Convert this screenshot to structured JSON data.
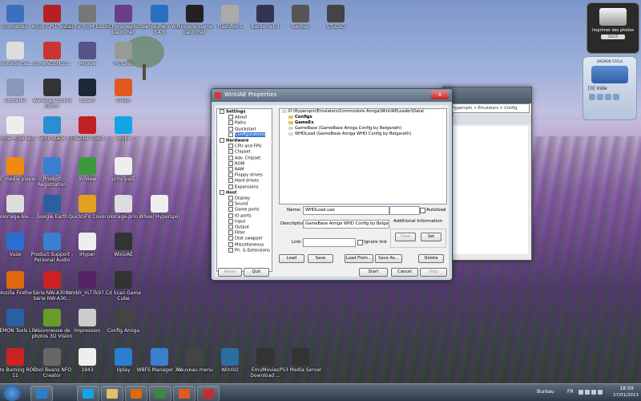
{
  "desktop_icons": [
    {
      "label": "Ordinateur",
      "color": "#3a70c0"
    },
    {
      "label": "ASUS GPU Tweak",
      "color": "#b52020"
    },
    {
      "label": "Gui for ROM Editor",
      "color": "#777777"
    },
    {
      "label": "Clrmamepro Launcher",
      "color": "#6a3d8a"
    },
    {
      "label": "OpenSkiPack Win 3.4.1",
      "color": "#2a6fc0"
    },
    {
      "label": "Pinnacle Game Launcher",
      "color": "#222222"
    },
    {
      "label": "Flashfire 2",
      "color": "#aaaaaa"
    },
    {
      "label": "Battle.net 3",
      "color": "#333355"
    },
    {
      "label": "Backup",
      "color": "#555555"
    },
    {
      "label": "STUDIO",
      "color": "#444444"
    },
    {
      "label": "coloriage-cas...",
      "color": "#dddddd"
    },
    {
      "label": "10_WNDSHOT...",
      "color": "#cc3333"
    },
    {
      "label": "Mirage",
      "color": "#555588"
    },
    {
      "label": "Pictures",
      "color": "#999999"
    },
    {
      "label": "Corbeille",
      "color": "#8899bb"
    },
    {
      "label": "WavePad Sound Editor",
      "color": "#333333"
    },
    {
      "label": "Steam",
      "color": "#1b2838"
    },
    {
      "label": "Origin",
      "color": "#e05a20"
    },
    {
      "label": "normal_colorie...",
      "color": "#eeeeee"
    },
    {
      "label": "SonicStage",
      "color": "#2a8fd0"
    },
    {
      "label": "FileZilla Client",
      "color": "#c02020"
    },
    {
      "label": "Skype",
      "color": "#12a5e3"
    },
    {
      "label": "VLC media player",
      "color": "#f08a10"
    },
    {
      "label": "Product Registration",
      "color": "#3a7fd0"
    },
    {
      "label": "XnView",
      "color": "#3a9a3a"
    },
    {
      "label": "principal5",
      "color": "#eeeeee"
    },
    {
      "label": "coloriage-ble...",
      "color": "#dddddd"
    },
    {
      "label": "Google Earth",
      "color": "#2a5fa0"
    },
    {
      "label": "QuickSFV Cover",
      "color": "#e0a020"
    },
    {
      "label": "coloriage-prin...",
      "color": "#dddddd"
    },
    {
      "label": "Wheel Hyperspin",
      "color": "#eeeeee"
    },
    {
      "label": "Vuze",
      "color": "#2a6fd0"
    },
    {
      "label": "Product Support - Personal Audio",
      "color": "#3a7fd0"
    },
    {
      "label": "iHyper",
      "color": "#eeeeee"
    },
    {
      "label": "WinUAE",
      "color": "#333333"
    },
    {
      "label": "Mozilla Firefox",
      "color": "#e06a10"
    },
    {
      "label": "Série NW-A3000 Série NW-A30...",
      "color": "#cc2222"
    },
    {
      "label": "tumblr_m77k97...",
      "color": "#552266"
    },
    {
      "label": "Cd Scan Game Cube",
      "color": "#333333"
    },
    {
      "label": "DAEMON Tools Lite",
      "color": "#2a5fa0"
    },
    {
      "label": "Visionneuse de photos 3D Vision",
      "color": "#6a9a2a"
    },
    {
      "label": "impression",
      "color": "#cccccc"
    },
    {
      "label": "Config Amiga",
      "color": "#444444"
    },
    {
      "label": "Nero Burning ROM 11",
      "color": "#cc2222"
    },
    {
      "label": "Cool Beans NFO Creator",
      "color": "#666666"
    },
    {
      "label": "1943",
      "color": "#eeeeee"
    },
    {
      "label": "Uplay",
      "color": "#2a7fd0"
    },
    {
      "label": "WBFS Manager 3.0",
      "color": "#3a7fd0"
    },
    {
      "label": "Nouveau menu",
      "color": "#444444"
    },
    {
      "label": "WinISO",
      "color": "#2a6fa0"
    },
    {
      "label": "EmuMovies Download ...",
      "color": "#333333"
    },
    {
      "label": "PS3 Media Server",
      "color": "#333333"
    }
  ],
  "gadget_printer": {
    "title": "Imprimer des photos",
    "tag": "10x15"
  },
  "gadget_daemon": {
    "title": "DAEMON TOOLS",
    "drive": "[0] Vide"
  },
  "bgwin": {
    "address": "Hyperspin > Emulators > Config Amiga"
  },
  "window": {
    "title": "WinUAE Properties",
    "close": "x",
    "tree": [
      {
        "label": "Settings",
        "level": 0
      },
      {
        "label": "About",
        "level": 1
      },
      {
        "label": "Paths",
        "level": 1
      },
      {
        "label": "Quickstart",
        "level": 1
      },
      {
        "label": "Configurations",
        "level": 1,
        "selected": true
      },
      {
        "label": "Hardware",
        "level": 0
      },
      {
        "label": "CPU and FPU",
        "level": 1
      },
      {
        "label": "Chipset",
        "level": 1
      },
      {
        "label": "Adv. Chipset",
        "level": 1
      },
      {
        "label": "ROM",
        "level": 1
      },
      {
        "label": "RAM",
        "level": 1
      },
      {
        "label": "Floppy drives",
        "level": 1
      },
      {
        "label": "Hard drives",
        "level": 1
      },
      {
        "label": "Expansions",
        "level": 1
      },
      {
        "label": "Host",
        "level": 0
      },
      {
        "label": "Display",
        "level": 1
      },
      {
        "label": "Sound",
        "level": 1
      },
      {
        "label": "Game ports",
        "level": 1
      },
      {
        "label": "IO ports",
        "level": 1
      },
      {
        "label": "Input",
        "level": 1
      },
      {
        "label": "Output",
        "level": 1
      },
      {
        "label": "Filter",
        "level": 1
      },
      {
        "label": "Disk swapper",
        "level": 1
      },
      {
        "label": "Miscellaneous",
        "level": 1
      },
      {
        "label": "Pri. & Extensions",
        "level": 1
      }
    ],
    "config_list": [
      {
        "label": "D:\\Hyperspin\\Emulators\\Commodore Amiga\\WinUAELoader\\Data\\",
        "bold": false,
        "indent": 0
      },
      {
        "label": "Configs",
        "bold": true,
        "indent": 1
      },
      {
        "label": "GameEx",
        "bold": true,
        "indent": 1
      },
      {
        "label": "GameBase (GameBase Amiga Config by Belgarath)",
        "bold": false,
        "indent": 1
      },
      {
        "label": "WHDLoad (GameBase Amiga WHD Config by Belgarath)",
        "bold": false,
        "indent": 1
      }
    ],
    "name_label": "Name:",
    "name_value": "WHDLoad.uae",
    "autoload_label": "Autoload",
    "description_label": "Description:",
    "description_value": "GameBase Amiga WHD Config by Belgara",
    "additional_label": "Additional Information",
    "view_label": "View",
    "set_label": "Set",
    "link_label": "Link:",
    "ignore_link_label": "Ignore link",
    "load_label": "Load",
    "save_label": "Save",
    "load_from_label": "Load From...",
    "save_as_label": "Save As...",
    "delete_label": "Delete",
    "reset_label": "Reset",
    "quit_label": "Quit",
    "start_label": "Start",
    "cancel_label": "Cancel",
    "help_label": "Help"
  },
  "taskbar": {
    "bureau": "Bureau",
    "lang": "FR",
    "time": "18:59",
    "date": "27/01/2013"
  }
}
